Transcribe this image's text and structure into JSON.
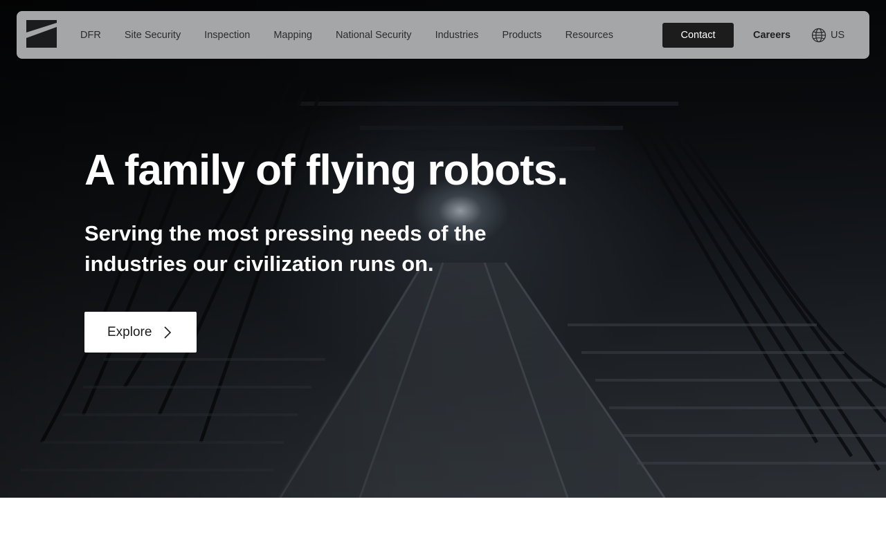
{
  "nav": {
    "logo_icon": "brand-logo",
    "links": [
      {
        "label": "DFR"
      },
      {
        "label": "Site Security"
      },
      {
        "label": "Inspection"
      },
      {
        "label": "Mapping"
      },
      {
        "label": "National Security"
      },
      {
        "label": "Industries"
      },
      {
        "label": "Products"
      },
      {
        "label": "Resources"
      }
    ],
    "contact_label": "Contact",
    "careers_label": "Careers",
    "locale_icon": "globe-icon",
    "locale_label": "US"
  },
  "hero": {
    "headline": "A family of flying robots.",
    "subline": "Serving the most pressing needs of the industries our civilization runs on.",
    "cta_label": "Explore",
    "cta_icon": "chevron-right-icon"
  },
  "colors": {
    "nav_bg": "#b2b4b6",
    "button_dark": "#1c1c1d",
    "hero_text": "#ffffff"
  }
}
